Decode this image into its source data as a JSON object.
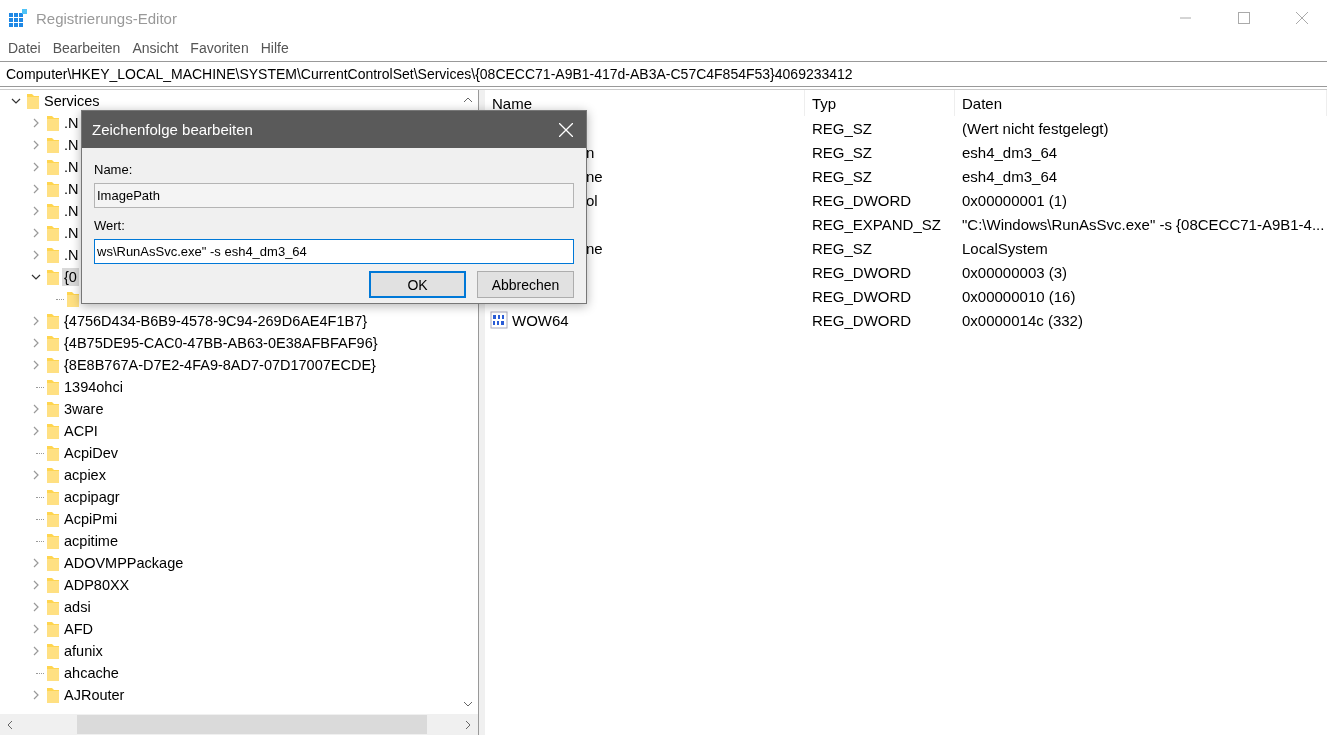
{
  "window": {
    "title": "Registrierungs-Editor"
  },
  "menu": [
    "Datei",
    "Bearbeiten",
    "Ansicht",
    "Favoriten",
    "Hilfe"
  ],
  "address": "Computer\\HKEY_LOCAL_MACHINE\\SYSTEM\\CurrentControlSet\\Services\\{08CECC71-A9B1-417d-AB3A-C57C4F854F53}4069233412",
  "tree": [
    {
      "label": "Services",
      "expandable": true,
      "expanded": true,
      "selected": false,
      "children": [
        {
          "label": ".N",
          "expandable": true,
          "selected": false
        },
        {
          "label": ".N",
          "expandable": true,
          "selected": false
        },
        {
          "label": ".N",
          "expandable": true,
          "selected": false
        },
        {
          "label": ".N",
          "expandable": true,
          "selected": false
        },
        {
          "label": ".N",
          "expandable": true,
          "selected": false
        },
        {
          "label": ".N",
          "expandable": true,
          "selected": false
        },
        {
          "label": ".N",
          "expandable": true,
          "selected": false
        },
        {
          "label": "{0",
          "expandable": true,
          "expanded": true,
          "selected": true,
          "children": [
            {
              "expandable": false
            }
          ]
        },
        {
          "label": "{4756D434-B6B9-4578-9C94-269D6AE4F1B7}",
          "expandable": true,
          "selected": false
        },
        {
          "label": "{4B75DE95-CAC0-47BB-AB63-0E38AFBFAF96}",
          "expandable": true,
          "selected": false
        },
        {
          "label": "{8E8B767A-D7E2-4FA9-8AD7-07D17007ECDE}",
          "expandable": true,
          "selected": false
        },
        {
          "label": "1394ohci",
          "expandable": false,
          "selected": false
        },
        {
          "label": "3ware",
          "expandable": true,
          "selected": false
        },
        {
          "label": "ACPI",
          "expandable": true,
          "selected": false
        },
        {
          "label": "AcpiDev",
          "expandable": false,
          "selected": false
        },
        {
          "label": "acpiex",
          "expandable": true,
          "selected": false
        },
        {
          "label": "acpipagr",
          "expandable": false,
          "selected": false
        },
        {
          "label": "AcpiPmi",
          "expandable": false,
          "selected": false
        },
        {
          "label": "acpitime",
          "expandable": false,
          "selected": false
        },
        {
          "label": "ADOVMPPackage",
          "expandable": true,
          "selected": false
        },
        {
          "label": "ADP80XX",
          "expandable": true,
          "selected": false
        },
        {
          "label": "adsi",
          "expandable": true,
          "selected": false
        },
        {
          "label": "AFD",
          "expandable": true,
          "selected": false
        },
        {
          "label": "afunix",
          "expandable": true,
          "selected": false
        },
        {
          "label": "ahcache",
          "expandable": false,
          "selected": false
        },
        {
          "label": "AJRouter",
          "expandable": true,
          "selected": false
        }
      ]
    }
  ],
  "values": {
    "columns": [
      "Name",
      "Typ",
      "Daten"
    ],
    "rows": [
      {
        "type": "REG_SZ",
        "data": "(Wert nicht festgelegt)"
      },
      {
        "covered": true,
        "name": "n",
        "type": "REG_SZ",
        "data": "esh4_dm3_64"
      },
      {
        "covered": true,
        "name": "ne",
        "type": "REG_SZ",
        "data": "esh4_dm3_64"
      },
      {
        "covered": true,
        "name": "ol",
        "type": "REG_DWORD",
        "data": "0x00000001 (1)"
      },
      {
        "type": "REG_EXPAND_SZ",
        "data": "\"C:\\Windows\\RunAsSvc.exe\" -s {08CECC71-A9B1-4..."
      },
      {
        "covered": true,
        "name": "ne",
        "type": "REG_SZ",
        "data": "LocalSystem"
      },
      {
        "type": "REG_DWORD",
        "data": "0x00000003 (3)"
      },
      {
        "type": "REG_DWORD",
        "data": "0x00000010 (16)"
      },
      {
        "covered": false,
        "name": "WOW64",
        "type": "REG_DWORD",
        "data": "0x0000014c (332)"
      }
    ]
  },
  "dialog": {
    "title": "Zeichenfolge bearbeiten",
    "name_label": "Name:",
    "name_value": "ImagePath",
    "value_label": "Wert:",
    "value_value": "ws\\RunAsSvc.exe\" -s esh4_dm3_64",
    "buttons": [
      {
        "label": "OK",
        "default": true
      },
      {
        "label": "Abbrechen",
        "default": false
      }
    ]
  }
}
